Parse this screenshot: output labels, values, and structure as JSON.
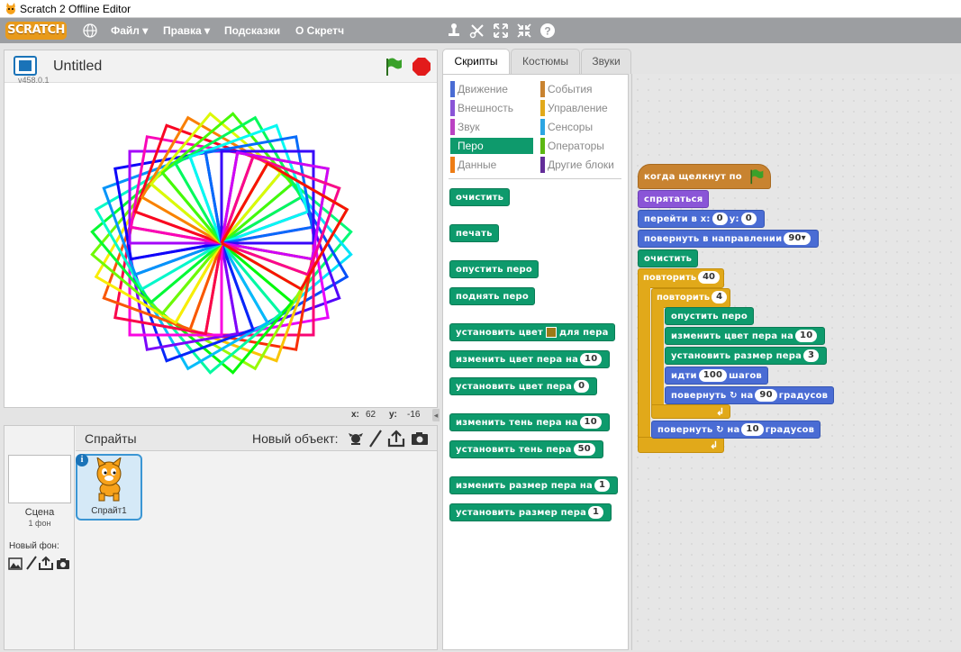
{
  "window": {
    "title": "Scratch 2 Offline Editor"
  },
  "menubar": {
    "logo": "SCRATCH",
    "items": [
      "Файл ▾",
      "Правка ▾",
      "Подсказки",
      "О Скретч"
    ]
  },
  "stage": {
    "title": "Untitled",
    "version": "v458.0.1",
    "x_label": "x:",
    "x_value": "62",
    "y_label": "y:",
    "y_value": "-16"
  },
  "sprites_panel": {
    "header": "Спрайты",
    "new_object_label": "Новый объект:",
    "scene_label": "Сцена",
    "scene_backdrops": "1 фон",
    "new_backdrop_label": "Новый фон:",
    "sprites": [
      {
        "name": "Спрайт1"
      }
    ]
  },
  "tabs": [
    "Скрипты",
    "Костюмы",
    "Звуки"
  ],
  "categories": [
    {
      "label": "Движение",
      "color": "#4a6cd4"
    },
    {
      "label": "События",
      "color": "#c88330"
    },
    {
      "label": "Внешность",
      "color": "#8a55d7"
    },
    {
      "label": "Управление",
      "color": "#e1a91a"
    },
    {
      "label": "Звук",
      "color": "#bb42c3"
    },
    {
      "label": "Сенсоры",
      "color": "#2ca5e2"
    },
    {
      "label": "Перо",
      "color": "#0e9a6c"
    },
    {
      "label": "Операторы",
      "color": "#5cb712"
    },
    {
      "label": "Данные",
      "color": "#ee7d16"
    },
    {
      "label": "Другие блоки",
      "color": "#632d99"
    }
  ],
  "palette": {
    "clear": "очистить",
    "stamp": "печать",
    "pen_down": "опустить перо",
    "pen_up": "поднять перо",
    "set_color_a": "установить цвет",
    "set_color_b": "для пера",
    "change_color": "изменить цвет пера на",
    "change_color_val": "10",
    "set_color_to": "установить цвет пера",
    "set_color_to_val": "0",
    "change_shade": "изменить тень пера на",
    "change_shade_val": "10",
    "set_shade": "установить тень пера",
    "set_shade_val": "50",
    "change_size": "изменить размер пера на",
    "change_size_val": "1",
    "set_size": "установить размер пера",
    "set_size_val": "1"
  },
  "script": {
    "hat": "когда щелкнут по",
    "hide": "спрятаться",
    "goto_a": "перейти в x:",
    "goto_x": "0",
    "goto_b": "y:",
    "goto_y": "0",
    "point_dir": "повернуть в направлении",
    "point_val": "90▾",
    "clear": "очистить",
    "repeat_outer": "повторить",
    "repeat_outer_val": "40",
    "repeat_inner": "повторить",
    "repeat_inner_val": "4",
    "pen_down": "опустить перо",
    "change_color": "изменить цвет пера на",
    "change_color_val": "10",
    "set_size": "установить размер пера",
    "set_size_val": "3",
    "move_a": "идти",
    "move_val": "100",
    "move_b": "шагов",
    "turn1_a": "повернуть ↻ на",
    "turn1_val": "90",
    "turn1_b": "градусов",
    "turn2_a": "повернуть ↻ на",
    "turn2_val": "10",
    "turn2_b": "градусов"
  }
}
